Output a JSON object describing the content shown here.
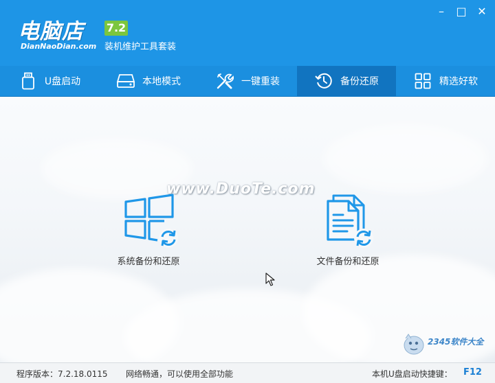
{
  "header": {
    "logo_text": "电脑店",
    "logo_sub": "DianNaoDian.com",
    "version_badge": "7.2",
    "tagline": "装机维护工具套装",
    "window_controls": {
      "minimize": "–",
      "maximize": "□",
      "close": "✕"
    }
  },
  "nav": {
    "items": [
      {
        "label": "U盘启动",
        "icon": "usb-drive-icon"
      },
      {
        "label": "本地模式",
        "icon": "hard-disk-icon"
      },
      {
        "label": "一键重装",
        "icon": "tools-icon"
      },
      {
        "label": "备份还原",
        "icon": "restore-clock-icon",
        "active": true
      },
      {
        "label": "精选好软",
        "icon": "app-grid-icon"
      }
    ]
  },
  "main": {
    "watermark": "www.DuoTe.com",
    "features": [
      {
        "label": "系统备份和还原",
        "icon": "windows-sync-icon"
      },
      {
        "label": "文件备份和还原",
        "icon": "document-sync-icon"
      }
    ],
    "brand_mark": "2345软件大全"
  },
  "status": {
    "version_label": "程序版本：7.2.18.0115",
    "network": "网络畅通，可以使用全部功能",
    "hotkey_label": "本机U盘启动快捷键：",
    "hotkey": "F12"
  },
  "colors": {
    "header_bg": "#1e95e6",
    "nav_active_bg": "#1174c0",
    "icon_blue": "#1f97e8",
    "badge_green": "#7cc63e",
    "hotkey_blue": "#1a7fd4"
  }
}
